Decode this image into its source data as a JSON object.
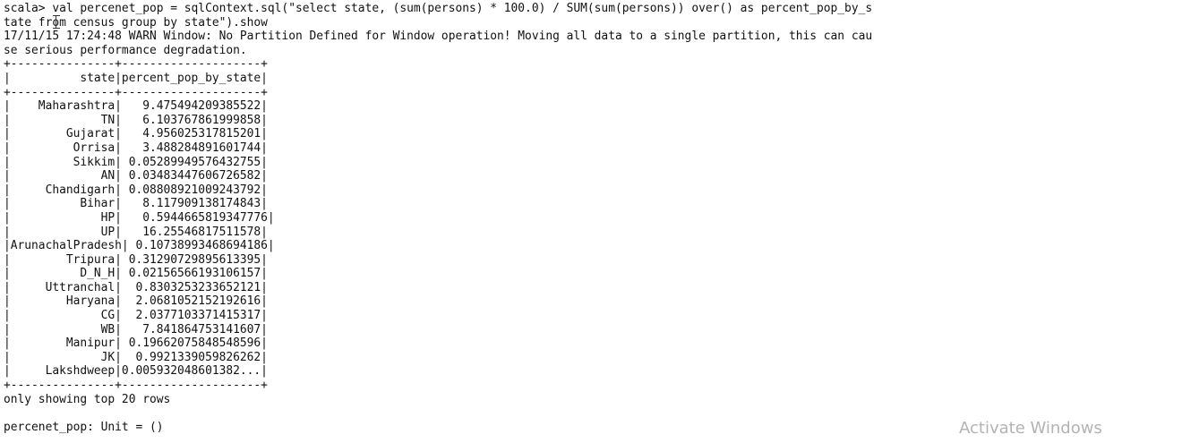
{
  "terminal": {
    "lines": [
      "scala> val percenet_pop = sqlContext.sql(\"select state, (sum(persons) * 100.0) / SUM(sum(persons)) over() as percent_pop_by_s",
      "tate from census group by state\").show",
      "17/11/15 17:24:48 WARN Window: No Partition Defined for Window operation! Moving all data to a single partition, this can cau",
      "se serious performance degradation.",
      "+---------------+--------------------+",
      "|          state|percent_pop_by_state|",
      "+---------------+--------------------+",
      "|    Maharashtra|   9.475494209385522|",
      "|             TN|   6.103767861999858|",
      "|        Gujarat|   4.956025317815201|",
      "|         Orrisa|   3.488284891601744|",
      "|         Sikkim| 0.05289949576432755|",
      "|             AN| 0.03483447606726582|",
      "|     Chandigarh| 0.08808921009243792|",
      "|          Bihar|   8.117909138174843|",
      "|             HP|   0.5944665819347776|",
      "|             UP|   16.25546817511578|",
      "|ArunachalPradesh| 0.10738993468694186|",
      "|        Tripura| 0.31290729895613395|",
      "|          D_N_H| 0.02156566193106157|",
      "|     Uttranchal|  0.8303253233652121|",
      "|        Haryana|  2.0681052152192616|",
      "|             CG|  2.0377103371415317|",
      "|             WB|   7.841864753141607|",
      "|        Manipur| 0.19662075848548596|",
      "|             JK|  0.9921339059826262|",
      "|     Lakshdweep|0.005932048601382...|",
      "+---------------+--------------------+",
      "only showing top 20 rows",
      "",
      "percenet_pop: Unit = ()"
    ]
  },
  "watermark": {
    "text": "Activate Windows"
  }
}
